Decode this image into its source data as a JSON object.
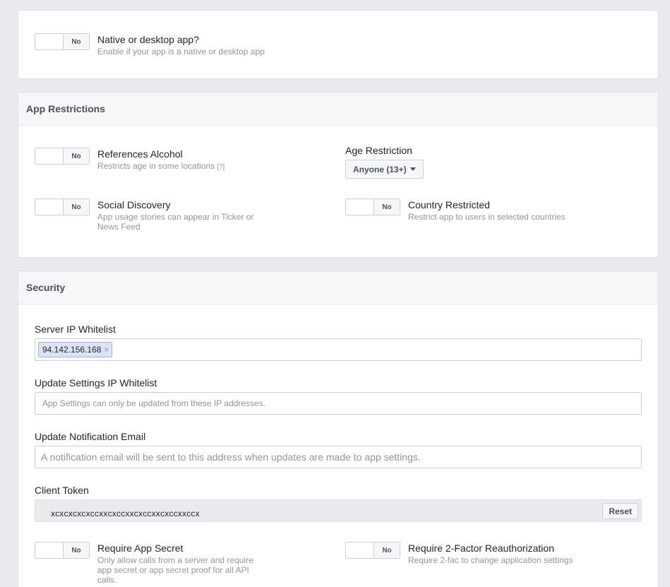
{
  "native_panel": {
    "toggle_state": "No",
    "title": "Native or desktop app?",
    "description": "Enable if your app is a native or desktop app"
  },
  "restrictions": {
    "header": "App Restrictions",
    "alcohol": {
      "toggle_state": "No",
      "title": "References Alcohol",
      "description": "Restricts age in some locations",
      "help": "[?]"
    },
    "age": {
      "label": "Age Restriction",
      "selected": "Anyone (13+)"
    },
    "social": {
      "toggle_state": "No",
      "title": "Social Discovery",
      "description": "App usage stories can appear in Ticker or News Feed"
    },
    "country": {
      "toggle_state": "No",
      "title": "Country Restricted",
      "description": "Restrict app to users in selected countries"
    }
  },
  "security": {
    "header": "Security",
    "server_ip": {
      "label": "Server IP Whitelist",
      "chips": [
        "94.142.156.168"
      ],
      "remove_glyph": "×"
    },
    "update_ip": {
      "label": "Update Settings IP Whitelist",
      "placeholder": "App Settings can only be updated from these IP addresses."
    },
    "notify_email": {
      "label": "Update Notification Email",
      "placeholder": "A notification email will be sent to this address when updates are made to app settings."
    },
    "client_token": {
      "label": "Client Token",
      "value": "xcxcxcxcxccxxcxccxxcxccxxcxccxxccx",
      "reset_label": "Reset"
    },
    "app_secret": {
      "toggle_state": "No",
      "title": "Require App Secret",
      "description": "Only allow calls from a server and require app secret or app secret proof for all API calls."
    },
    "two_factor": {
      "toggle_state": "No",
      "title": "Require 2-Factor Reauthorization",
      "description": "Require 2-fac to change application settings"
    }
  }
}
